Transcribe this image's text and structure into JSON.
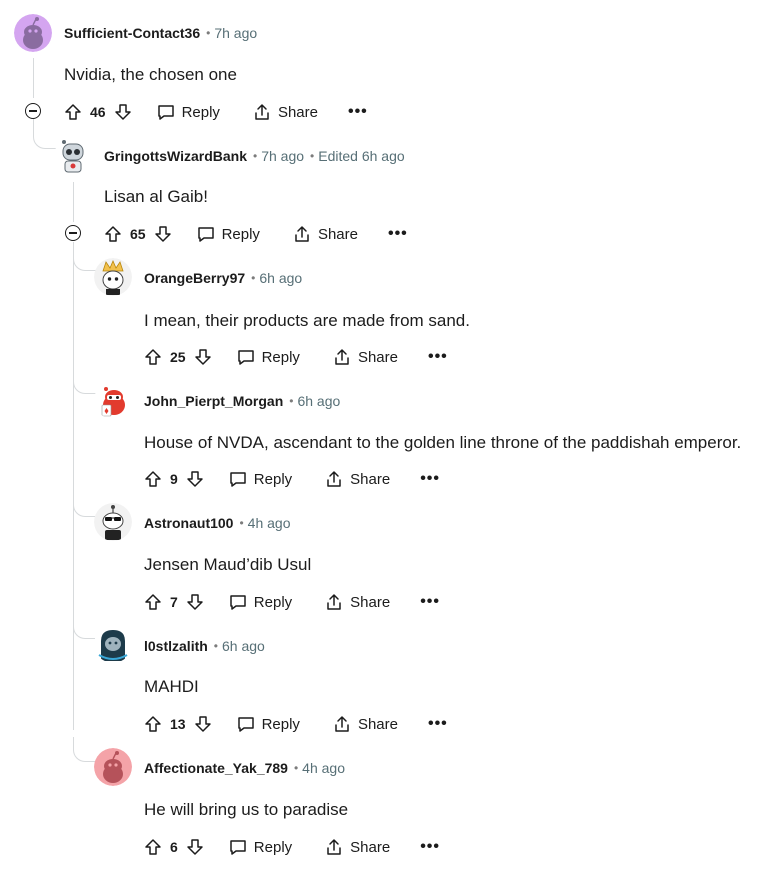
{
  "labels": {
    "reply": "Reply",
    "share": "Share",
    "more": "•••"
  },
  "comments": [
    {
      "author": "Sufficient-Contact36",
      "time": "7h ago",
      "edited": "",
      "text": "Nvidia, the chosen one",
      "score": "46",
      "avatar_icon": "snoo-avatar-purple"
    },
    {
      "author": "GringottsWizardBank",
      "time": "7h ago",
      "edited": "Edited 6h ago",
      "text": "Lisan al Gaib!",
      "score": "65",
      "avatar_icon": "robot-avatar"
    },
    {
      "author": "OrangeBerry97",
      "time": "6h ago",
      "edited": "",
      "text": "I mean, their products are made from sand.",
      "score": "25",
      "avatar_icon": "crowned-avatar"
    },
    {
      "author": "John_Pierpt_Morgan",
      "time": "6h ago",
      "edited": "",
      "text": "House of NVDA, ascendant to the golden line throne of the paddishah emperor.",
      "score": "9",
      "avatar_icon": "red-snoo-avatar"
    },
    {
      "author": "Astronaut100",
      "time": "4h ago",
      "edited": "",
      "text": "Jensen Maud’dib Usul",
      "score": "7",
      "avatar_icon": "sunglasses-avatar"
    },
    {
      "author": "l0stlzalith",
      "time": "6h ago",
      "edited": "",
      "text": "MAHDI",
      "score": "13",
      "avatar_icon": "hooded-avatar"
    },
    {
      "author": "Affectionate_Yak_789",
      "time": "4h ago",
      "edited": "",
      "text": "He will bring us to paradise",
      "score": "6",
      "avatar_icon": "snoo-avatar-pink"
    }
  ]
}
